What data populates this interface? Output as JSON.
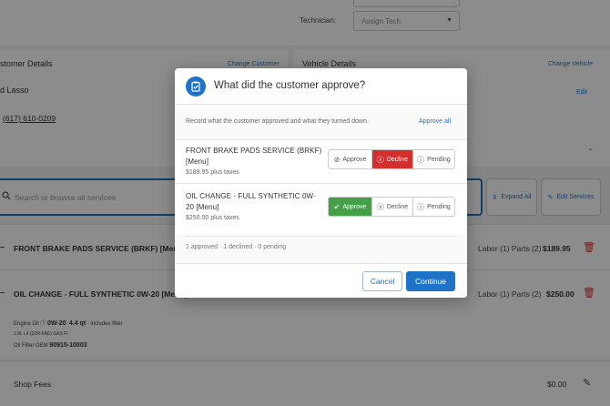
{
  "background": {
    "technician_label": "Technician:",
    "technician_placeholder": "Assign Tech",
    "customer": {
      "title": "stomer Details",
      "change_link": "Change Customer",
      "name": "d Lasso",
      "phone": "(617) 610-0209"
    },
    "vehicle": {
      "title": "Vehicle Details",
      "change_link": "Change Vehicle",
      "edit_link": "Edit"
    },
    "search_placeholder": "Search or browse all services",
    "expand_all": "Expand All",
    "edit_services": "Edit Services",
    "services": [
      {
        "name": "FRONT BRAKE PADS SERVICE (BRKF) [Menu]",
        "labor": "Labor (1) Parts (2)",
        "price": "$189.95"
      },
      {
        "name": "OIL CHANGE - FULL SYNTHETIC 0W-20 [Menu]",
        "labor": "Labor (1) Parts (2)",
        "price": "$250.00"
      }
    ],
    "oil_details": {
      "engine_oil_label": "Engine Oil",
      "engine_oil_grade": "0W-20",
      "engine_oil_qty": "4.4 qt",
      "engine_oil_note": "· includes filter",
      "engine_spec": "1.8L L4 (2ZR-FAE) GAS FI",
      "oil_filter_label": "Oil Filter OEM",
      "oil_filter_part": "90915-10003"
    },
    "shop_fees": {
      "name": "Shop Fees",
      "price": "$0.00"
    }
  },
  "modal": {
    "title": "What did the customer approve?",
    "instructions": "Record what the customer approved and what they turned down.",
    "approve_all": "Approve all",
    "items": [
      {
        "name": "FRONT BRAKE PADS SERVICE (BRKF) [Menu]",
        "price": "$189.95 plus taxes",
        "status": "declined"
      },
      {
        "name": "OIL CHANGE - FULL SYNTHETIC 0W-20 [Menu]",
        "price": "$250.00 plus taxes",
        "status": "approved"
      }
    ],
    "labels": {
      "approve": "Approve",
      "decline": "Decline",
      "pending": "Pending"
    },
    "summary": "1 approved · 1 declined · 0 pending",
    "cancel": "Cancel",
    "continue": "Continue"
  },
  "colors": {
    "accent": "#1e73c9",
    "approved": "#43a047",
    "declined": "#d32f2f"
  }
}
